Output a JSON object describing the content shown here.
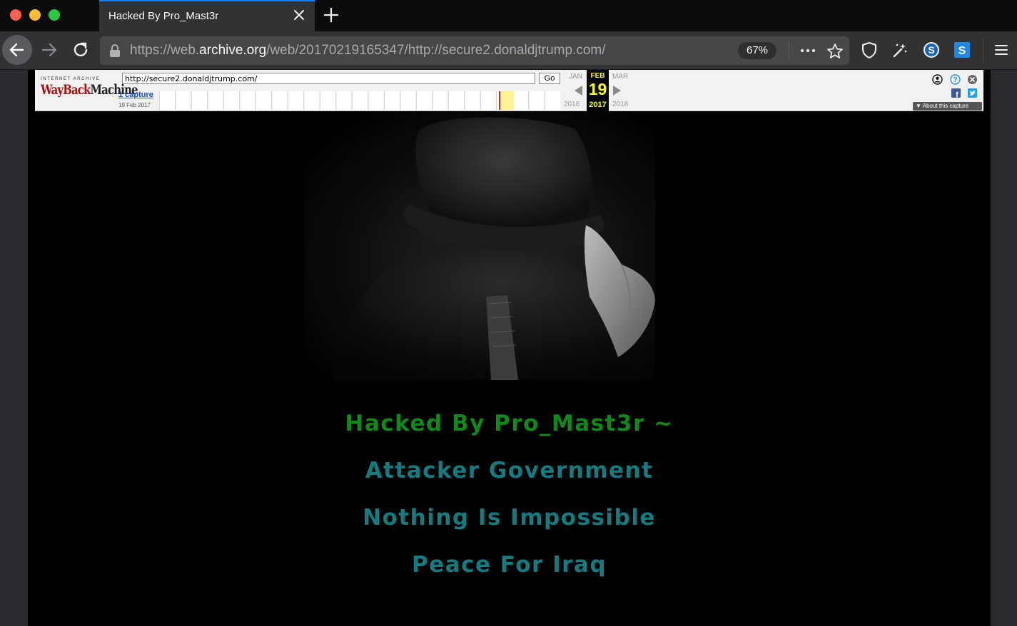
{
  "browser": {
    "tab_title": "Hacked By Pro_Mast3r",
    "url_prefix": "https://web.",
    "url_domain": "archive.org",
    "url_rest": "/web/20170219165347/http://secure2.donaldjtrump.com/",
    "zoom": "67%"
  },
  "wayback": {
    "logo_top": "INTERNET ARCHIVE",
    "logo_a": "WayBack",
    "logo_b": "Machine",
    "url_value": "http://secure2.donaldjtrump.com/",
    "go_label": "Go",
    "captures_label": "1 capture",
    "capture_date": "19 Feb 2017",
    "prev_month": "JAN",
    "cur_month": "FEB",
    "next_month": "MAR",
    "cur_day": "19",
    "prev_year": "2016",
    "cur_year": "2017",
    "next_year": "2018",
    "about_label": "About this capture"
  },
  "page": {
    "line1": "Hacked By Pro_Mast3r ~",
    "line2": "Attacker Government",
    "line3": "Nothing Is Impossible",
    "line4": "Peace For Iraq"
  },
  "colors": {
    "accent": "#0a84ff",
    "hack_green": "#0f8a1a",
    "hack_teal": "#127c80"
  },
  "icons": [
    "close-icon",
    "plus-icon",
    "back-arrow-icon",
    "forward-arrow-icon",
    "reload-icon",
    "lock-icon",
    "more-icon",
    "star-icon",
    "shield-icon",
    "wand-icon",
    "s-circle-icon",
    "s-square-icon",
    "hamburger-icon",
    "user-icon",
    "help-icon",
    "close-circle-icon",
    "facebook-icon",
    "twitter-icon"
  ]
}
